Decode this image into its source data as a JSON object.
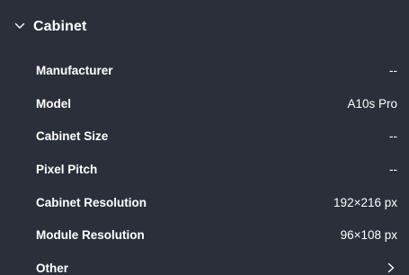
{
  "section": {
    "title": "Cabinet",
    "expanded": true,
    "icon": "chevron-down-icon"
  },
  "rows": [
    {
      "label": "Manufacturer",
      "value": "--"
    },
    {
      "label": "Model",
      "value": "A10s Pro"
    },
    {
      "label": "Cabinet Size",
      "value": "--"
    },
    {
      "label": "Pixel Pitch",
      "value": "--"
    },
    {
      "label": "Cabinet Resolution",
      "value": "192×216 px"
    },
    {
      "label": "Module Resolution",
      "value": "96×108 px"
    },
    {
      "label": "Other",
      "icon": "chevron-right-icon"
    }
  ],
  "colors": {
    "background": "#2a2f3a",
    "text": "#ffffff"
  }
}
